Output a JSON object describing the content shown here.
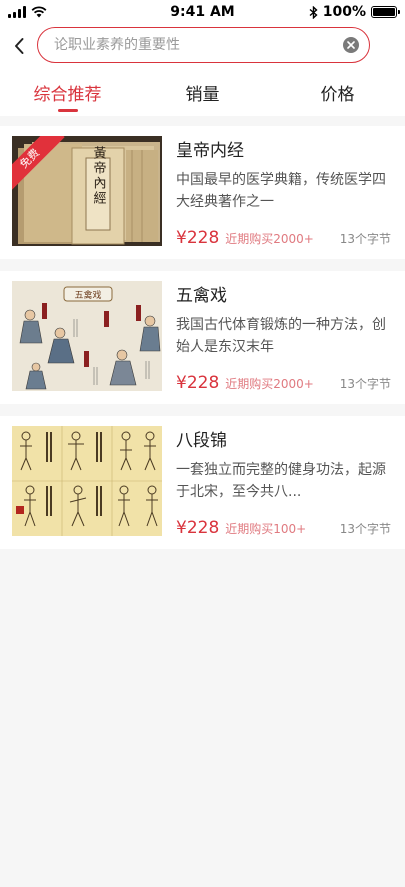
{
  "status_bar": {
    "time": "9:41 AM",
    "battery": "100%"
  },
  "search": {
    "placeholder": "论职业素养的重要性"
  },
  "tabs": [
    {
      "label": "综合推荐",
      "active": true
    },
    {
      "label": "销量",
      "active": false
    },
    {
      "label": "价格",
      "active": false
    }
  ],
  "items": [
    {
      "title": "皇帝内经",
      "description": "中国最早的医学典籍，传统医学四大经典著作之一",
      "price": "¥228",
      "bought": "近期购买2000+",
      "sections": "13个字节",
      "badge": "免费",
      "cover_text": "黃帝內經"
    },
    {
      "title": "五禽戏",
      "description": "我国古代体育锻炼的一种方法，创始人是东汉末年",
      "price": "¥228",
      "bought": "近期购买2000+",
      "sections": "13个字节",
      "cover_text": "五禽戏"
    },
    {
      "title": "八段锦",
      "description": "一套独立而完整的健身功法，起源于北宋，至今共八...",
      "price": "¥228",
      "bought": "近期购买100+",
      "sections": "13个字节"
    }
  ],
  "colors": {
    "accent": "#d9343d",
    "price": "#d9343d",
    "bought": "#e07a80",
    "background": "#f6f6f6"
  }
}
